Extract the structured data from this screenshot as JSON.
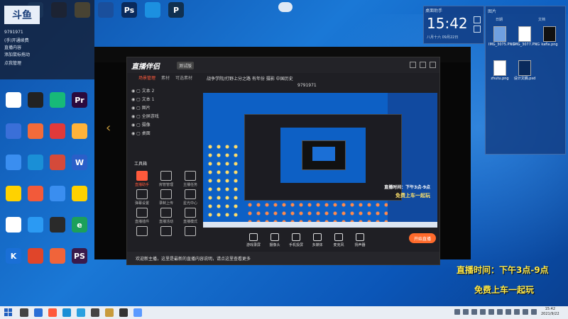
{
  "desktop": {
    "top_icons": [
      {
        "label": "",
        "color": "#2a7fd6"
      },
      {
        "label": "",
        "color": "#3a3a3a"
      },
      {
        "label": "",
        "color": "#ffc83a"
      },
      {
        "label": "",
        "color": "#1a4f9c"
      },
      {
        "label": "Ps",
        "color": "#0a2a5c"
      },
      {
        "label": "",
        "color": "#1c90e0"
      },
      {
        "label": "P",
        "color": "#103050"
      }
    ],
    "left_icons": [
      {
        "label": "",
        "color": "#ffffff"
      },
      {
        "label": "",
        "color": "#222222"
      },
      {
        "label": "",
        "color": "#17b978"
      },
      {
        "label": "Pr",
        "color": "#2b0a3d"
      },
      {
        "label": "",
        "color": "#3a6fd8"
      },
      {
        "label": "",
        "color": "#f26b3a"
      },
      {
        "label": "",
        "color": "#e03a3a"
      },
      {
        "label": "",
        "color": "#ffb33a"
      },
      {
        "label": "",
        "color": "#3a8ef0"
      },
      {
        "label": "",
        "color": "#1a8fd6"
      },
      {
        "label": "",
        "color": "#d44a3a"
      },
      {
        "label": "W",
        "color": "#2a5fc8"
      },
      {
        "label": "",
        "color": "#ffd200"
      },
      {
        "label": "",
        "color": "#f25a3a"
      },
      {
        "label": "",
        "color": "#3a8ef0"
      },
      {
        "label": "",
        "color": "#ffd200"
      },
      {
        "label": "",
        "color": "#ffffff"
      },
      {
        "label": "",
        "color": "#2b9af3"
      },
      {
        "label": "",
        "color": "#2a2a2a"
      },
      {
        "label": "e",
        "color": "#1ca05a"
      },
      {
        "label": "K",
        "color": "#1a6fd6"
      },
      {
        "label": "",
        "color": "#e0452a"
      },
      {
        "label": "",
        "color": "#f0643a"
      },
      {
        "label": "PS",
        "color": "#3a1a4a"
      }
    ]
  },
  "top_left_panel": {
    "logo": "斗鱼",
    "lines": [
      "9791971",
      "(手)开通续费",
      "直播内容",
      "添加鼠标拖动",
      "点我管理"
    ]
  },
  "livecompanion": {
    "logo": "直播伴侣",
    "badge": "测试版",
    "tabs": [
      "场景管理",
      "素材",
      "可选素材"
    ],
    "scenes": [
      "文本 2",
      "文本 1",
      "图片",
      "全屏游戏",
      "摄像",
      "桌面"
    ],
    "tools_title": "工具箱",
    "tools": [
      "直播助手",
      "房管管理",
      "主播任务",
      "弹幕设置",
      "录制上传",
      "星光中心",
      "直播插件",
      "直播活动",
      "直播模式",
      "",
      "",
      ""
    ],
    "info": "战争学院/打野上分之路   有年份   摄影   中国历史",
    "room_id": "9791971",
    "preview_overlay1": "直播时间：下午3点-9点",
    "preview_overlay2": "免费上车一起玩",
    "bottom_items": [
      "游戏录屏",
      "摄像头",
      "手机投屏",
      "多媒体",
      "麦克风",
      "扬声器"
    ],
    "live_button": "开始直播",
    "notice": "欢迎新主播，这里是最新的直播内容说明，请点这里查看更多"
  },
  "widgets": {
    "clock_title": "桌面助手",
    "clock_time": "15:42",
    "clock_date": "八月十六  09月22日",
    "files_title": "图片",
    "files_headers": [
      "日期",
      "文档"
    ],
    "files": [
      {
        "name": "IMG_3075.PNG",
        "color": "#6fa0e0"
      },
      {
        "name": "IMG_3077.PNG",
        "color": "#ffffff"
      },
      {
        "name": "kafla.png",
        "color": "#111111"
      },
      {
        "name": "zhutu.png",
        "color": "#ffffff"
      },
      {
        "name": "设计文稿.psd",
        "color": "#0a2a5c"
      }
    ]
  },
  "overlay_text": {
    "line1": "直播时间：下午3点-9点",
    "line2": "免费上车一起玩"
  },
  "taskbar": {
    "time": "15:42",
    "date": "2021/9/22",
    "pinned_colors": [
      "#444444",
      "#2a6fd6",
      "#ff5a3a",
      "#1a8fd6",
      "#2aa0e0",
      "#444444",
      "#c89b3c",
      "#333333",
      "#5a9aff"
    ]
  }
}
